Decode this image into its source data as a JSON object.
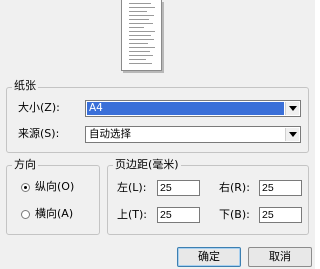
{
  "paper": {
    "title": "纸张",
    "size_label": "大小(Z):",
    "size_value": "A4",
    "source_label": "来源(S):",
    "source_value": "自动选择"
  },
  "orientation": {
    "title": "方向",
    "portrait_label": "纵向(O)",
    "landscape_label": "横向(A)",
    "selected": "portrait"
  },
  "margins": {
    "title": "页边距(毫米)",
    "left_label": "左(L):",
    "left_value": "25",
    "right_label": "右(R):",
    "right_value": "25",
    "top_label": "上(T):",
    "top_value": "25",
    "bottom_label": "下(B):",
    "bottom_value": "25"
  },
  "buttons": {
    "ok": "确定",
    "cancel": "取消"
  }
}
